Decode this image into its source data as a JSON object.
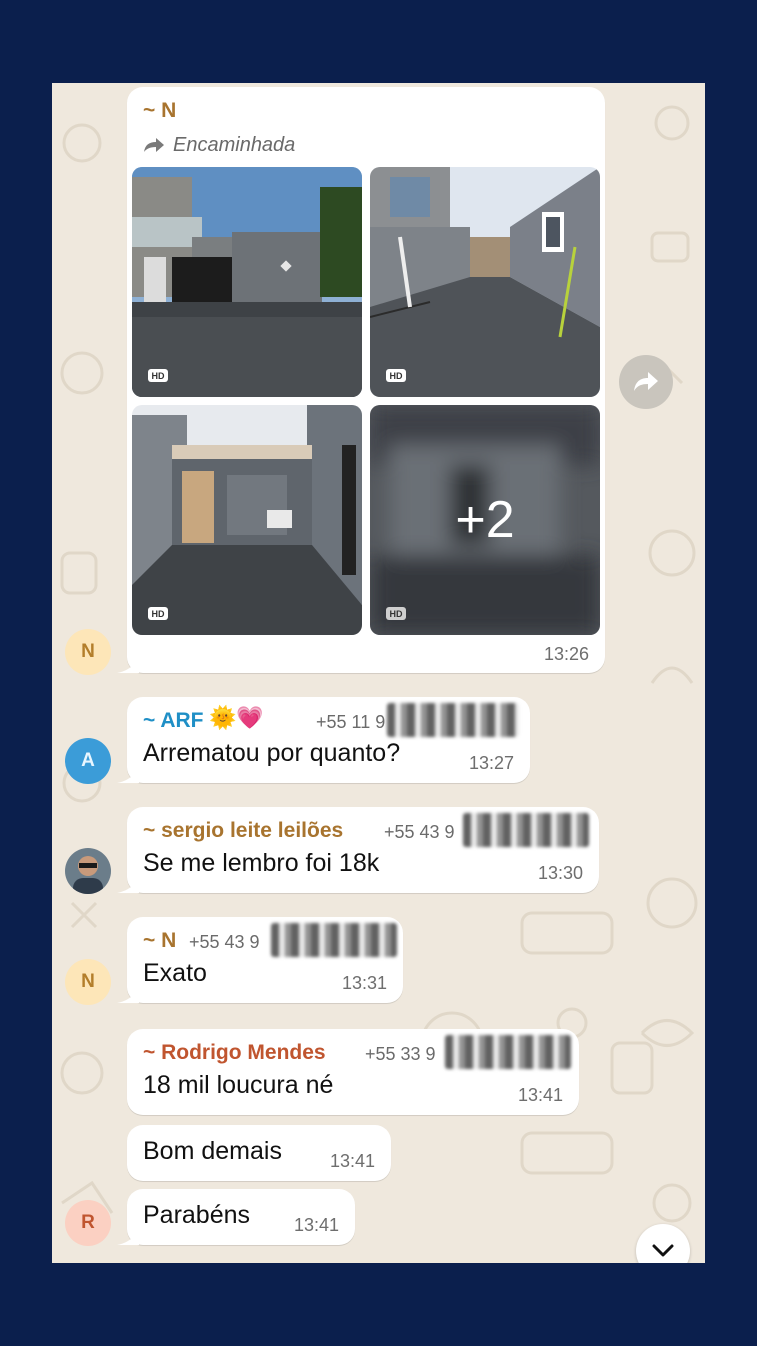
{
  "forwarded_post": {
    "sender": "~ N",
    "forwarded_label": "Encaminhada",
    "photos": [
      {
        "badge": "HD"
      },
      {
        "badge": "HD"
      },
      {
        "badge": "HD"
      },
      {
        "badge": "HD",
        "overlay": "+2"
      }
    ],
    "time": "13:26",
    "avatar_initial": "N"
  },
  "messages": [
    {
      "sender": "~ ARF",
      "sender_color": "#1f8fc6",
      "emoji": "🌞💗",
      "phone": "+55 11 9",
      "text": "Arrematou por quanto?",
      "time": "13:27",
      "avatar_initial": "A"
    },
    {
      "sender": "~ sergio leite leilões",
      "sender_color": "#a8742f",
      "phone": "+55 43 9",
      "text": "Se me lembro foi 18k",
      "time": "13:30"
    },
    {
      "sender": "~ N",
      "sender_color": "#a8742f",
      "phone": "+55 43 9",
      "text": "Exato",
      "time": "13:31",
      "avatar_initial": "N"
    },
    {
      "sender": "~ Rodrigo Mendes",
      "sender_color": "#c0552f",
      "phone": "+55 33 9",
      "text": "18 mil loucura né",
      "time": "13:41"
    },
    {
      "text": "Bom demais",
      "time": "13:41"
    },
    {
      "text": "Parabéns",
      "time": "13:41",
      "avatar_initial": "R"
    }
  ],
  "icons": {
    "forward": "share-forward-icon",
    "scroll_down": "chevron-down-icon"
  },
  "colors": {
    "page_background": "#0b1f4d",
    "chat_background": "#efe8dd",
    "bubble": "#ffffff"
  }
}
